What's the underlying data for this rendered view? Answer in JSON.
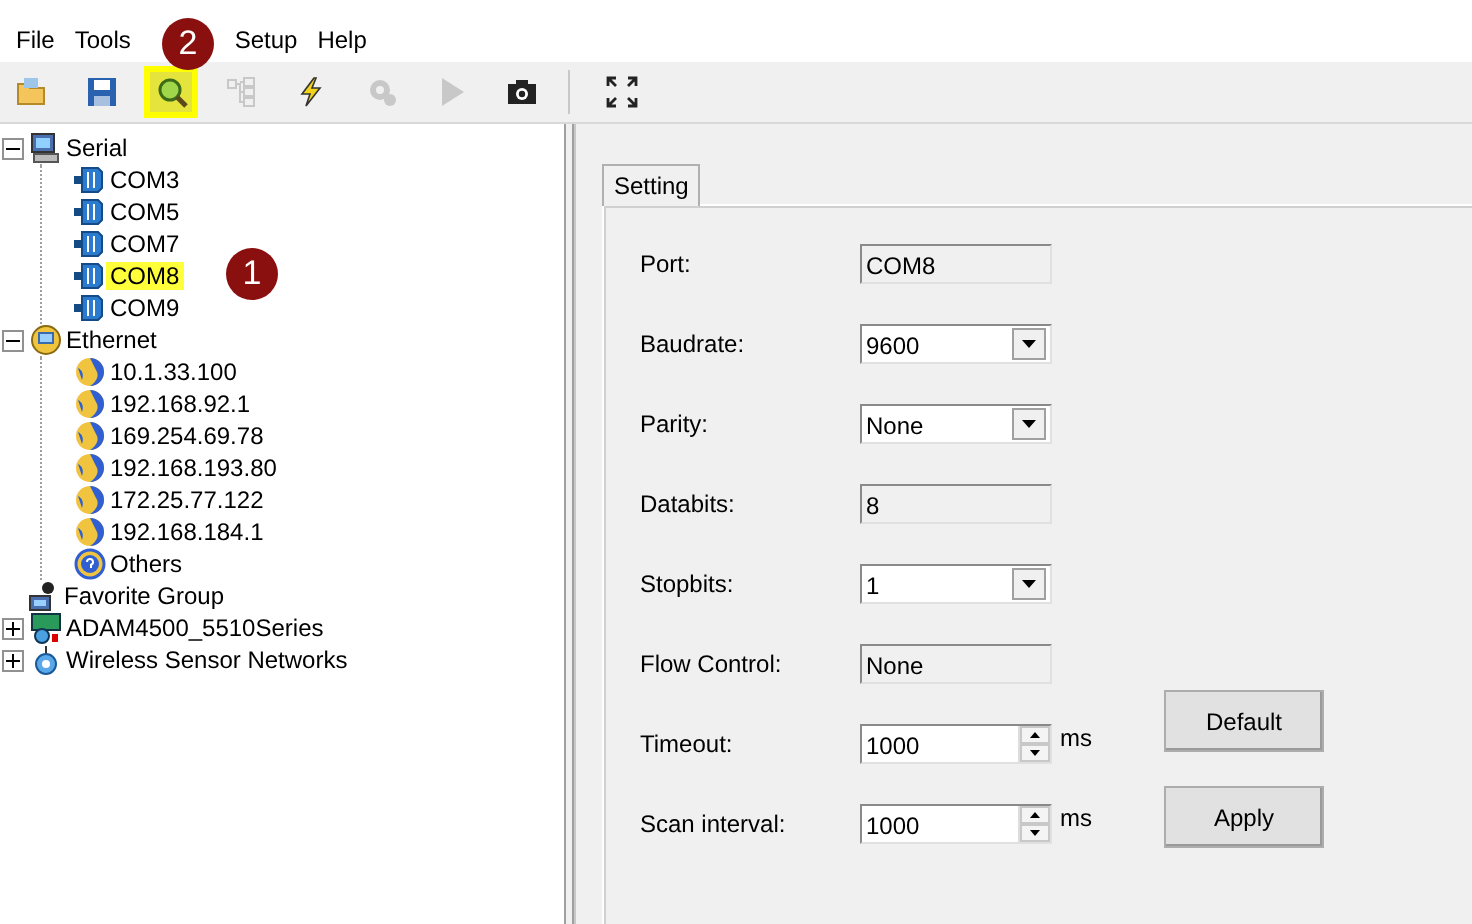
{
  "menu": [
    {
      "label": "File"
    },
    {
      "label": "Tools"
    },
    {
      "label": "Setup"
    },
    {
      "label": "Help"
    }
  ],
  "toolbar_groups": [
    {
      "buttons": [
        {
          "kind": "open",
          "disabled": false,
          "highlighted": false
        },
        {
          "kind": "save",
          "disabled": false,
          "highlighted": false
        },
        {
          "kind": "search",
          "disabled": false,
          "highlighted": true,
          "badge": "2"
        },
        {
          "kind": "tree",
          "disabled": true,
          "highlighted": false
        },
        {
          "kind": "flash",
          "disabled": false,
          "highlighted": false
        },
        {
          "kind": "gear",
          "disabled": true,
          "highlighted": false
        },
        {
          "kind": "play",
          "disabled": true,
          "highlighted": false
        },
        {
          "kind": "camera",
          "disabled": false,
          "highlighted": false
        }
      ]
    },
    {
      "buttons": [
        {
          "kind": "fullscreen",
          "disabled": false,
          "highlighted": false
        }
      ]
    }
  ],
  "tree": [
    {
      "label": "Serial",
      "kind": "computer",
      "expanded": true,
      "children": [
        {
          "label": "COM3",
          "kind": "port",
          "highlighted": false
        },
        {
          "label": "COM5",
          "kind": "port",
          "highlighted": false
        },
        {
          "label": "COM7",
          "kind": "port",
          "highlighted": false
        },
        {
          "label": "COM8",
          "kind": "port",
          "highlighted": true,
          "badge": "1"
        },
        {
          "label": "COM9",
          "kind": "port",
          "highlighted": false
        }
      ]
    },
    {
      "label": "Ethernet",
      "kind": "network",
      "expanded": true,
      "children": [
        {
          "label": "10.1.33.100",
          "kind": "globe",
          "highlighted": false
        },
        {
          "label": "192.168.92.1",
          "kind": "globe",
          "highlighted": false
        },
        {
          "label": "169.254.69.78",
          "kind": "globe",
          "highlighted": false
        },
        {
          "label": "192.168.193.80",
          "kind": "globe",
          "highlighted": false
        },
        {
          "label": "172.25.77.122",
          "kind": "globe",
          "highlighted": false
        },
        {
          "label": "192.168.184.1",
          "kind": "globe",
          "highlighted": false
        },
        {
          "label": "Others",
          "kind": "help",
          "highlighted": false
        }
      ]
    },
    {
      "label": "Favorite Group",
      "kind": "favorite"
    },
    {
      "label": "ADAM4500_5510Series",
      "kind": "module",
      "expanded": false
    },
    {
      "label": "Wireless Sensor Networks",
      "kind": "wireless",
      "expanded": false
    }
  ],
  "tabs": [
    {
      "label": "Setting",
      "selected": true
    }
  ],
  "fields": [
    {
      "label": "Port:",
      "kind": "readonly",
      "value": "COM8"
    },
    {
      "label": "Baudrate:",
      "kind": "select",
      "value": "9600"
    },
    {
      "label": "Parity:",
      "kind": "select",
      "value": "None"
    },
    {
      "label": "Databits:",
      "kind": "readonly",
      "value": "8"
    },
    {
      "label": "Stopbits:",
      "kind": "select",
      "value": "1"
    },
    {
      "label": "Flow Control:",
      "kind": "readonly",
      "value": "None"
    },
    {
      "label": "Timeout:",
      "kind": "spin",
      "value": "1000",
      "unit": "ms"
    },
    {
      "label": "Scan interval:",
      "kind": "spin",
      "value": "1000",
      "unit": "ms"
    }
  ],
  "buttons": [
    "Default",
    "Apply"
  ]
}
